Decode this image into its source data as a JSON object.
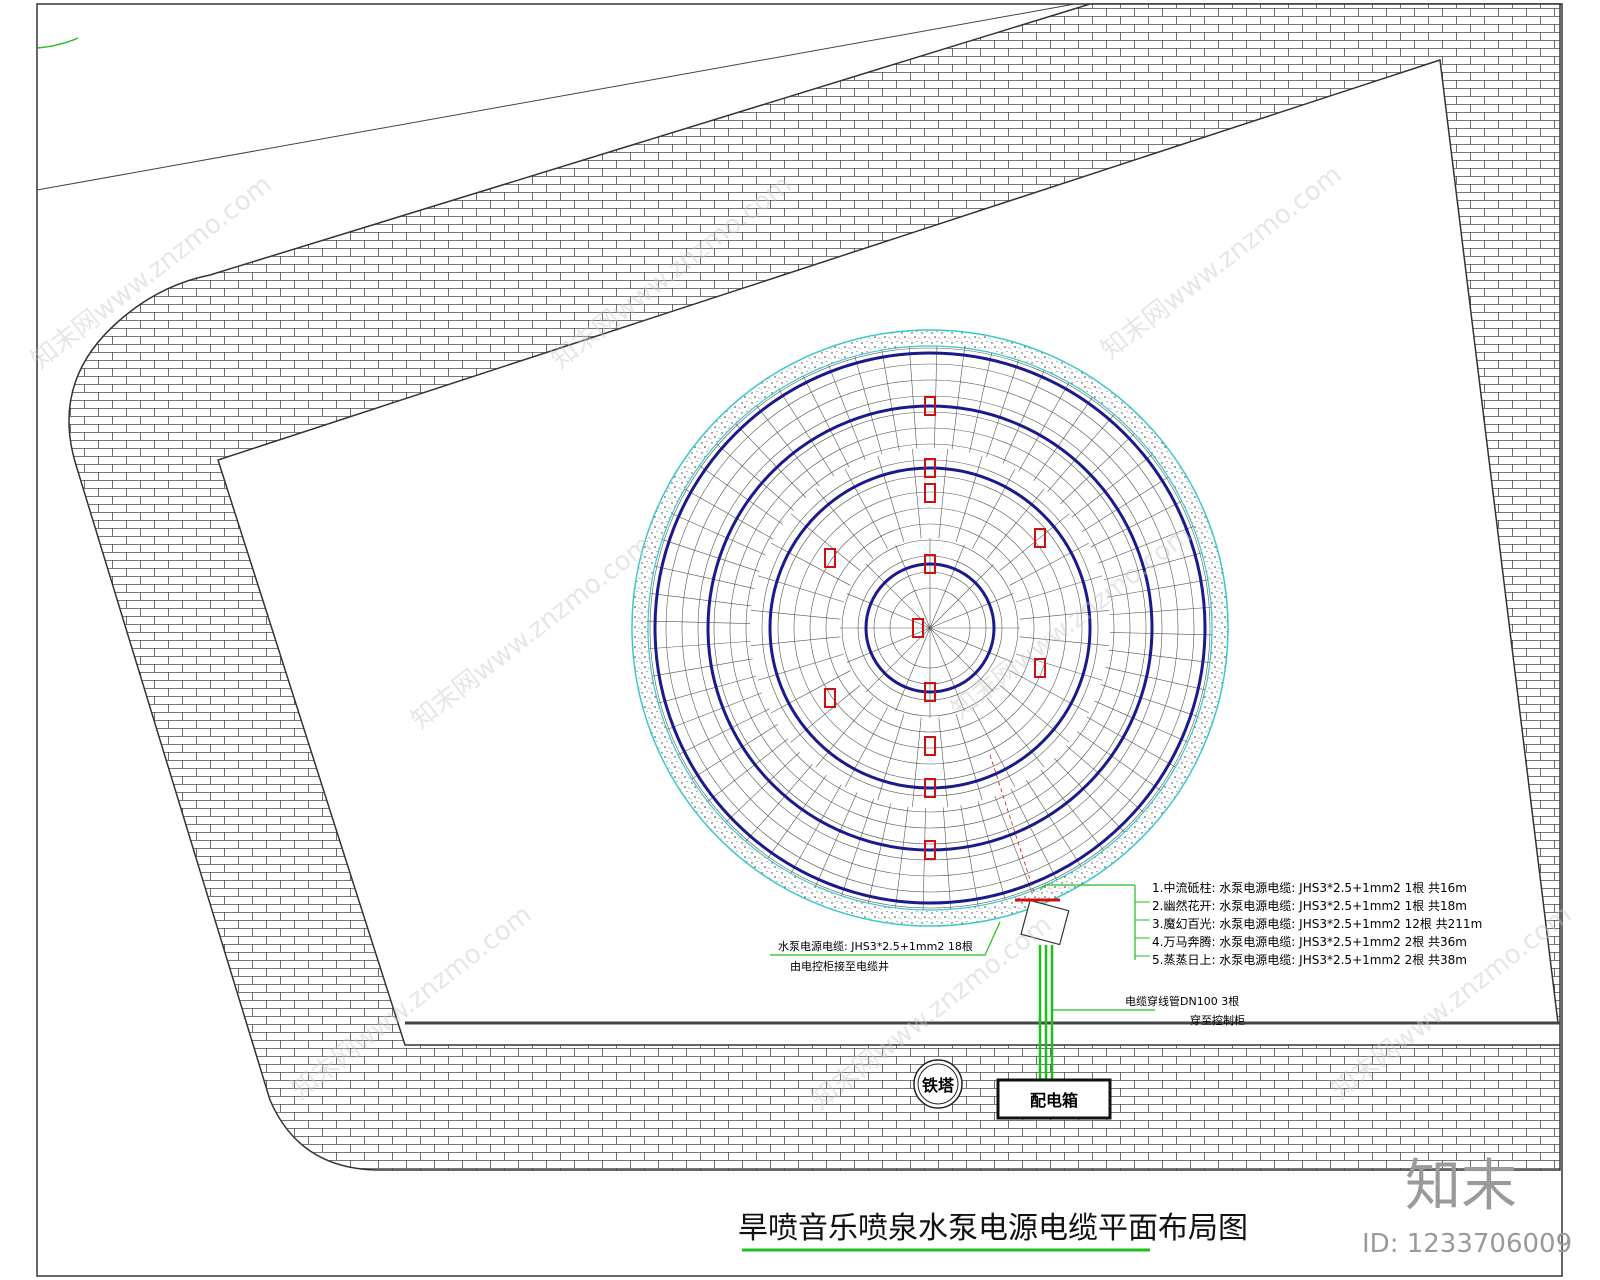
{
  "title": "旱喷音乐喷泉水泵电源电缆平面布局图",
  "distribution_box": "配电箱",
  "tower": "铁塔",
  "legend": [
    "1.中流砥柱: 水泵电源电缆: JHS3*2.5+1mm2 1根 共16m",
    "2.幽然花开: 水泵电源电缆: JHS3*2.5+1mm2 1根 共18m",
    "3.魔幻百光: 水泵电源电缆: JHS3*2.5+1mm2 12根 共211m",
    "4.万马奔腾: 水泵电源电缆: JHS3*2.5+1mm2 2根 共36m",
    "5.蒸蒸日上: 水泵电源电缆: JHS3*2.5+1mm2 2根 共38m"
  ],
  "pump_cable_note": {
    "line1": "水泵电源电缆: JHS3*2.5+1mm2 18根",
    "line2": "由电控柜接至电缆井"
  },
  "conduit_note": {
    "line1": "电缆穿线管DN100 3根",
    "line2": "穿至控制柜"
  },
  "watermark": {
    "text": "知末网www.znzmo.com",
    "logo": "知末",
    "id": "ID: 1233706009"
  },
  "colors": {
    "paving_line": "#555555",
    "ring": "#1a1a8c",
    "cable": "#1dbf1d",
    "pump": "#d01010",
    "pool_edge": "#3cc8c8",
    "title_underline": "#1dbf1d"
  }
}
